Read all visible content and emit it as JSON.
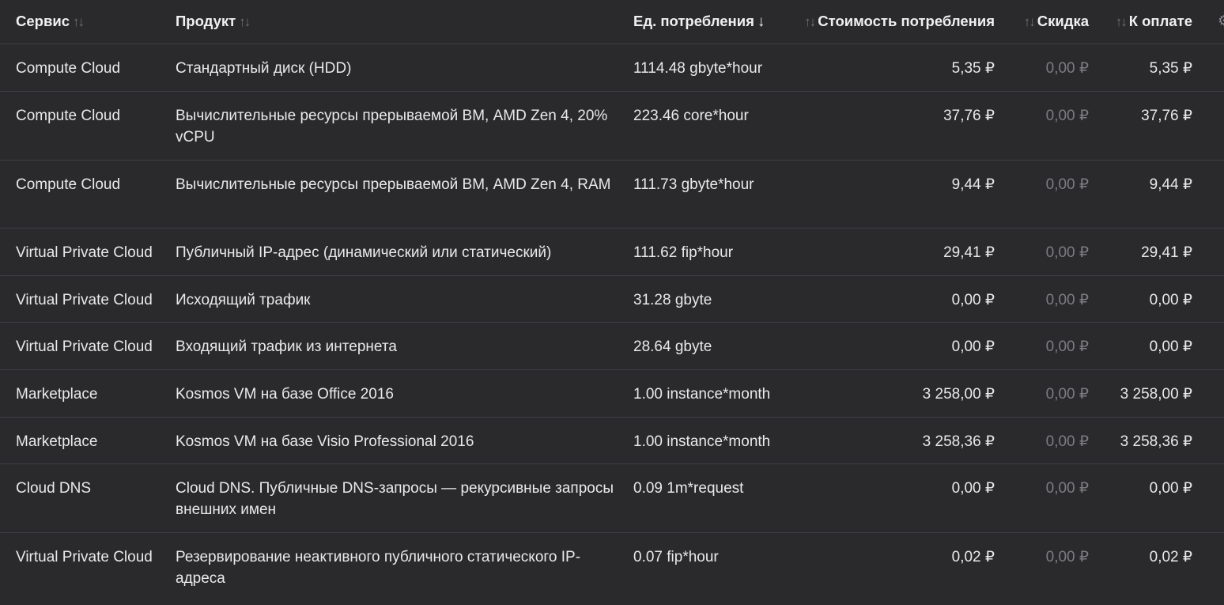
{
  "header": {
    "service": "Сервис",
    "product": "Продукт",
    "units": "Ед. потребления",
    "cost": "Стоимость потребления",
    "discount": "Скидка",
    "pay": "К оплате"
  },
  "icons": {
    "sort": "sort-arrows-icon",
    "sort_active": "sort-desc-arrow-icon",
    "settings": "settings-icon"
  },
  "rows": [
    {
      "service": "Compute Cloud",
      "product": "Стандартный диск (HDD)",
      "units": "1114.48 gbyte*hour",
      "cost": "5,35 ₽",
      "discount": "0,00 ₽",
      "pay": "5,35 ₽"
    },
    {
      "service": "Compute Cloud",
      "product": "Вычислительные ресурсы прерываемой ВМ, AMD Zen 4, 20% vCPU",
      "units": "223.46 core*hour",
      "cost": "37,76 ₽",
      "discount": "0,00 ₽",
      "pay": "37,76 ₽"
    },
    {
      "service": "Compute Cloud",
      "product": "Вычислительные ресурсы прерываемой ВМ, AMD Zen 4, RAM",
      "units": "111.73 gbyte*hour",
      "cost": "9,44 ₽",
      "discount": "0,00 ₽",
      "pay": "9,44 ₽"
    },
    {
      "service": "Virtual Private Cloud",
      "product": "Публичный IP-адрес (динамический или статический)",
      "units": "111.62 fip*hour",
      "cost": "29,41 ₽",
      "discount": "0,00 ₽",
      "pay": "29,41 ₽"
    },
    {
      "service": "Virtual Private Cloud",
      "product": "Исходящий трафик",
      "units": "31.28 gbyte",
      "cost": "0,00 ₽",
      "discount": "0,00 ₽",
      "pay": "0,00 ₽"
    },
    {
      "service": "Virtual Private Cloud",
      "product": "Входящий трафик из интернета",
      "units": "28.64 gbyte",
      "cost": "0,00 ₽",
      "discount": "0,00 ₽",
      "pay": "0,00 ₽"
    },
    {
      "service": "Marketplace",
      "product": "Kosmos VM на базе Office 2016",
      "units": "1.00 instance*month",
      "cost": "3 258,00 ₽",
      "discount": "0,00 ₽",
      "pay": "3 258,00 ₽"
    },
    {
      "service": "Marketplace",
      "product": "Kosmos VM на базе Visio Professional 2016",
      "units": "1.00 instance*month",
      "cost": "3 258,36 ₽",
      "discount": "0,00 ₽",
      "pay": "3 258,36 ₽"
    },
    {
      "service": "Cloud DNS",
      "product": "Cloud DNS. Публичные DNS-запросы — рекурсивные запросы внешних имен",
      "units": "0.09 1m*request",
      "cost": "0,00 ₽",
      "discount": "0,00 ₽",
      "pay": "0,00 ₽"
    },
    {
      "service": "Virtual Private Cloud",
      "product": "Резервирование неактивного публичного статического IP-адреса",
      "units": "0.07 fip*hour",
      "cost": "0,02 ₽",
      "discount": "0,00 ₽",
      "pay": "0,02 ₽"
    }
  ]
}
